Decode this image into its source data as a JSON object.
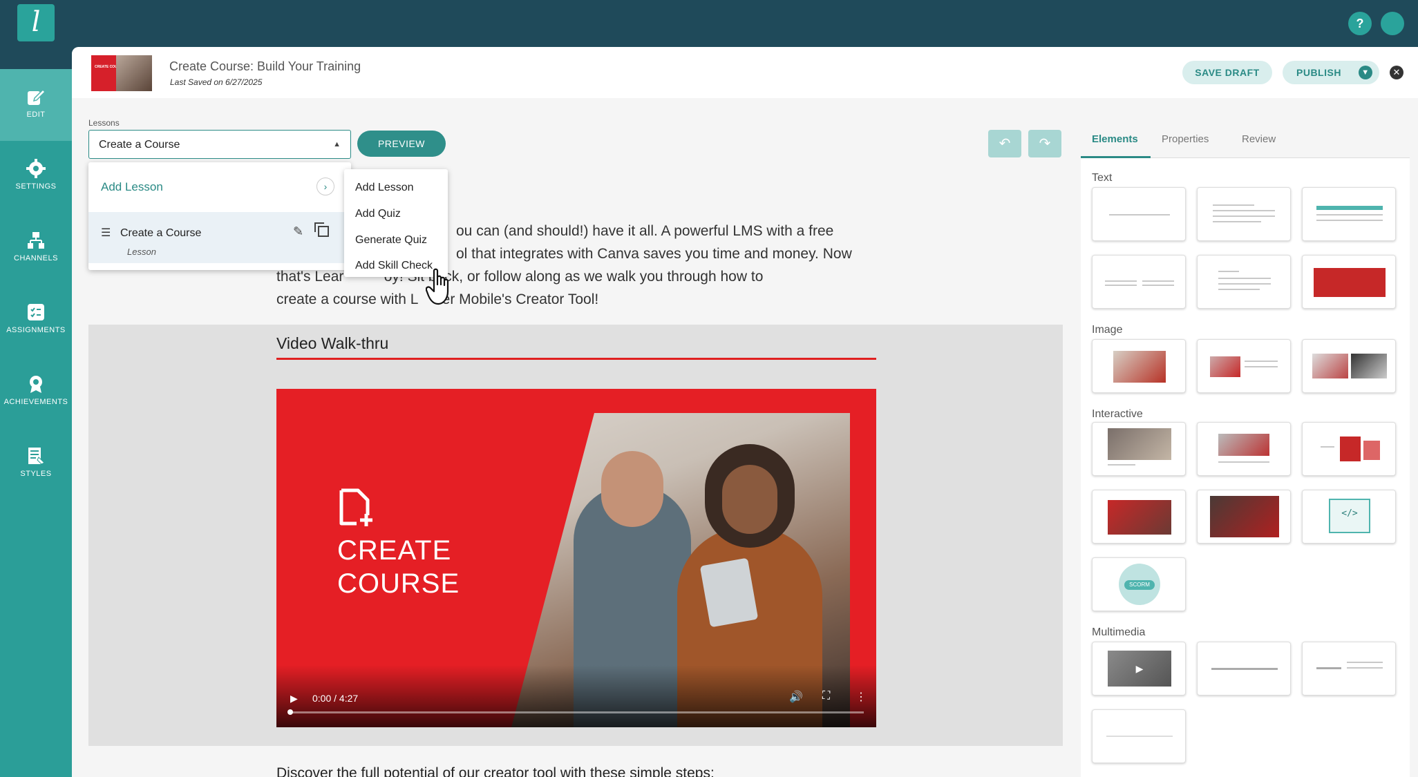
{
  "app": {
    "logo_letter": "l",
    "help_label": "?"
  },
  "sidenav": {
    "items": [
      {
        "label": "EDIT",
        "icon": "edit-icon",
        "active": true
      },
      {
        "label": "SETTINGS",
        "icon": "gear-icon",
        "active": false
      },
      {
        "label": "CHANNELS",
        "icon": "channels-icon",
        "active": false
      },
      {
        "label": "ASSIGNMENTS",
        "icon": "assignments-icon",
        "active": false
      },
      {
        "label": "ACHIEVEMENTS",
        "icon": "award-icon",
        "active": false
      },
      {
        "label": "STYLES",
        "icon": "styles-icon",
        "active": false
      }
    ]
  },
  "header": {
    "title": "Create Course: Build Your Training",
    "last_saved": "Last Saved on 6/27/2025",
    "save_draft": "SAVE DRAFT",
    "publish": "PUBLISH",
    "thumb_text": "CREATE COURSE"
  },
  "lessons": {
    "label": "Lessons",
    "selected": "Create a Course",
    "preview": "PREVIEW",
    "add_lesson": "Add Lesson",
    "items": [
      {
        "name": "Create a Course",
        "type": "Lesson"
      }
    ]
  },
  "add_menu": {
    "items": [
      "Add Lesson",
      "Add Quiz",
      "Generate Quiz",
      "Add Skill Check"
    ]
  },
  "canvas": {
    "intro_lines": [
      "ou can (and should!) have it all.  A powerful LMS with a free",
      "ol that integrates with Canva saves you time and money. Now",
      "that's Lear          oy! Sit back, or follow along as we walk you through how to",
      "create a course with L      er Mobile's Creator Tool!"
    ],
    "video_heading": "Video Walk-thru",
    "video_title_line1": "CREATE",
    "video_title_line2": "COURSE",
    "video_time": "0:00 / 4:27",
    "discover": "Discover the full potential of our creator tool with these simple steps:"
  },
  "rpanel": {
    "tabs": [
      "Elements",
      "Properties",
      "Review"
    ],
    "sections": {
      "text": "Text",
      "image": "Image",
      "interactive": "Interactive",
      "multimedia": "Multimedia"
    },
    "scorm_label": "SCORM"
  },
  "colors": {
    "teal_dark": "#1f4a5a",
    "teal": "#2b9e98",
    "accent_red": "#e51f25"
  }
}
